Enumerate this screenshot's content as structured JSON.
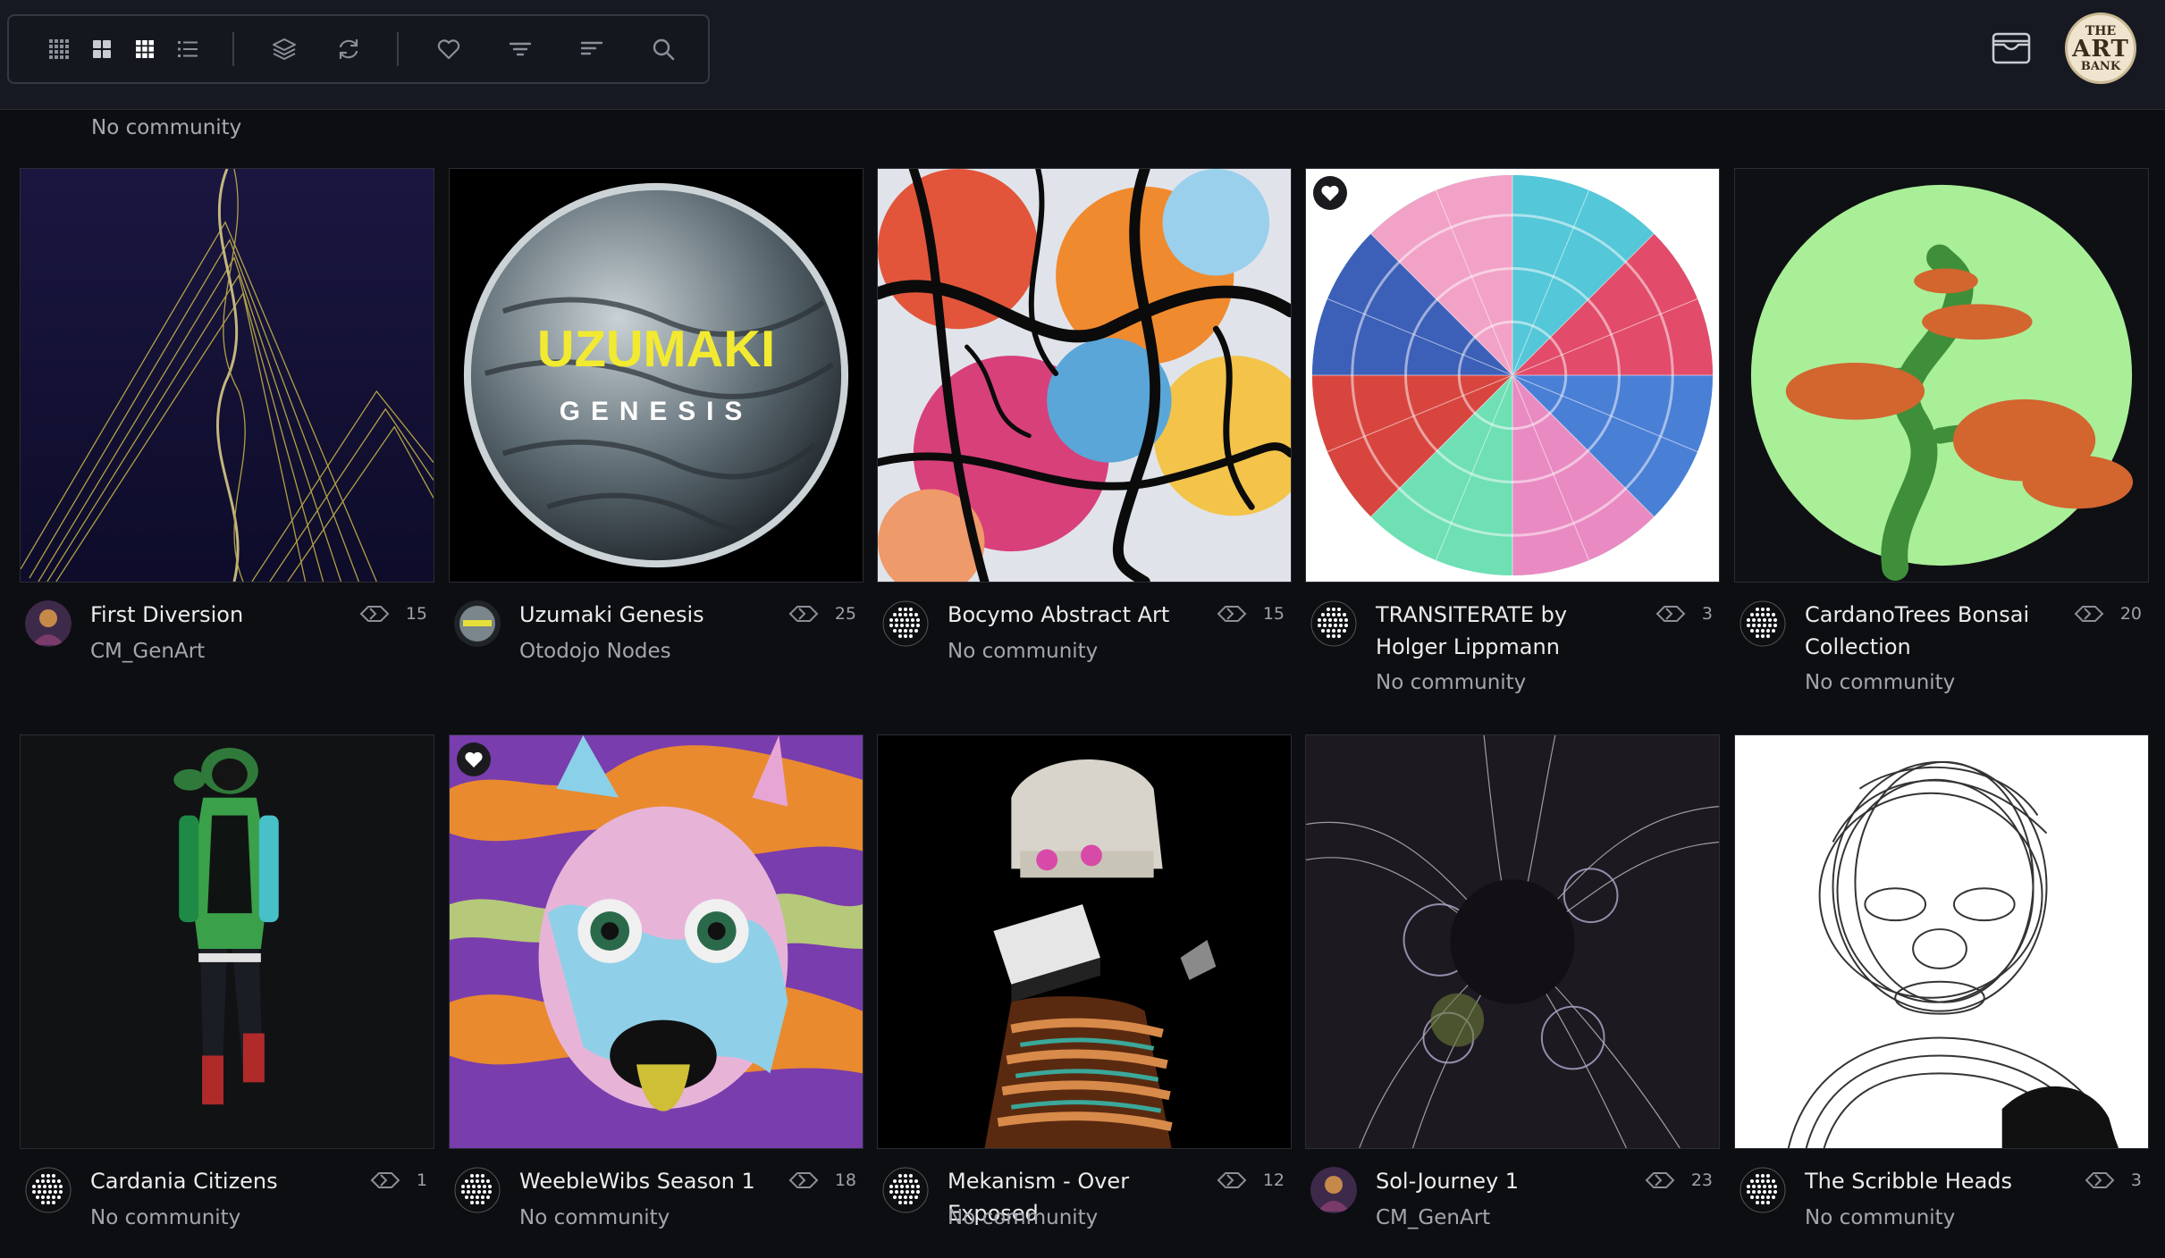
{
  "toolbar": {
    "icons": [
      "grid-dense-icon",
      "grid-large-icon",
      "grid-small-icon",
      "list-view-icon",
      "layers-icon",
      "refresh-icon",
      "heart-icon",
      "filter-icon",
      "sort-icon",
      "search-icon"
    ]
  },
  "header": {
    "wallet_icon": "wallet-icon",
    "logo": {
      "line1": "THE",
      "line2": "ART",
      "line3": "BANK"
    }
  },
  "previous_row": {
    "community": "No community"
  },
  "colors": {
    "background": "#0d0e12",
    "topbar": "#161921",
    "text": "#ececec",
    "muted": "#a3a6ad"
  },
  "collections": [
    {
      "name": "First Diversion",
      "community": "CM_GenArt",
      "count": "15",
      "favorited": false
    },
    {
      "name": "Uzumaki Genesis",
      "community": "Otodojo Nodes",
      "count": "25",
      "favorited": false,
      "art_text": {
        "line1": "UZUMAKI",
        "line2": "GENESIS"
      }
    },
    {
      "name": "Bocymo Abstract Art",
      "community": "No community",
      "count": "15",
      "favorited": false
    },
    {
      "name": "TRANSITERATE by Holger Lippmann",
      "community": "No community",
      "count": "3",
      "favorited": true
    },
    {
      "name": "CardanoTrees Bonsai Collection",
      "community": "No community",
      "count": "20",
      "favorited": false
    },
    {
      "name": "Cardania Citizens",
      "community": "No community",
      "count": "1",
      "favorited": false
    },
    {
      "name": "WeebleWibs Season 1",
      "community": "No community",
      "count": "18",
      "favorited": true
    },
    {
      "name": "Mekanism - Over Exposed",
      "community": "No community",
      "count": "12",
      "favorited": false
    },
    {
      "name": "Sol-Journey 1",
      "community": "CM_GenArt",
      "count": "23",
      "favorited": false
    },
    {
      "name": "The Scribble Heads",
      "community": "No community",
      "count": "3",
      "favorited": false
    }
  ]
}
